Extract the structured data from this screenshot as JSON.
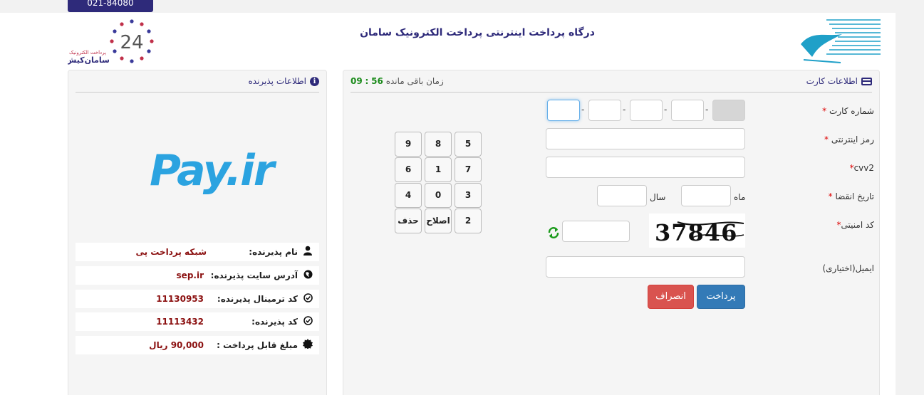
{
  "header": {
    "phone": "021-84080",
    "title": "درگاه پرداخت اینترنتی پرداخت الکترونیک سامان"
  },
  "logos": {
    "saman_line1": "پرداخت الکترونیک",
    "saman_line2": "سامان‌کیش",
    "saman_number": "24",
    "payir": "Pay.ir"
  },
  "merchant": {
    "title": "اطلاعات پذیرنده",
    "rows": [
      {
        "label": "نام پذیرنده:",
        "value": "شبکه پرداخت پی",
        "icon": "user-icon"
      },
      {
        "label": "آدرس سایت پذیرنده:",
        "value": "sep.ir",
        "icon": "globe-icon"
      },
      {
        "label": "کد ترمینال پذیرنده:",
        "value": "11130953",
        "icon": "check-circle-icon"
      },
      {
        "label": "کد پذیرنده:",
        "value": "11113432",
        "icon": "check-circle-icon"
      },
      {
        "label": "مبلغ قابل پرداخت :",
        "value": "90,000 ریال",
        "icon": "badge-icon"
      }
    ]
  },
  "card": {
    "title": "اطلاعات کارت",
    "timer_label": "زمان باقی مانده",
    "timer_min": "56",
    "timer_sep": ":",
    "timer_sec": "09",
    "labels": {
      "card_number": "شماره کارت",
      "password": "رمز اینترنتی",
      "cvv2": "cvv2",
      "expiry": "تاریخ انقضا",
      "month": "ماه",
      "year": "سال",
      "captcha": "کد امنیتی",
      "email": "ایمیل(اختیاری)"
    },
    "captcha_text": "37846",
    "required_mark": "*"
  },
  "keypad": {
    "keys": [
      "9",
      "8",
      "5",
      "6",
      "1",
      "7",
      "4",
      "0",
      "3",
      "حذف",
      "اصلاح",
      "2"
    ]
  },
  "buttons": {
    "pay": "پرداخت",
    "cancel": "انصراف"
  }
}
